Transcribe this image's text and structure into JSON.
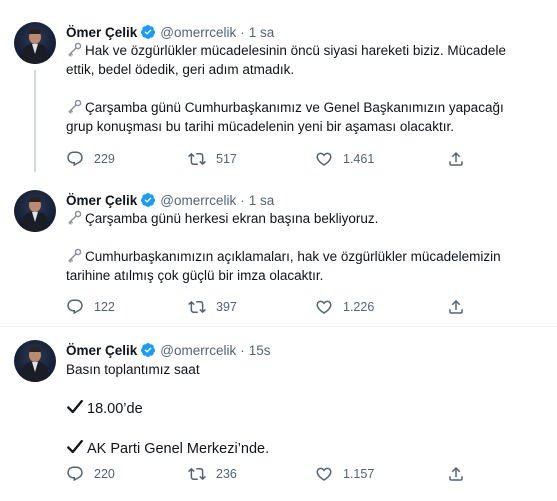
{
  "tweets": [
    {
      "author_name": "Ömer Çelik",
      "handle": "@omerrcelik",
      "separator": "·",
      "time": "1 sa",
      "paragraphs": [
        {
          "emoji": "key-icon",
          "lines": [
            "Hak ve özgürlükler mücadelesinin öncü siyasi hareketi biziz. Mücadele",
            "ettik, bedel ödedik, geri adım atmadık."
          ]
        },
        {
          "emoji": "key-icon",
          "lines": [
            "Çarşamba günü Cumhurbaşkanımız ve Genel Başkanımızın yapacağı",
            "grup konuşması bu tarihi mücadelenin yeni bir aşaması olacaktır."
          ]
        }
      ],
      "stats": {
        "replies": "229",
        "retweets": "517",
        "likes": "1.461"
      }
    },
    {
      "author_name": "Ömer Çelik",
      "handle": "@omerrcelik",
      "separator": "·",
      "time": "1 sa",
      "paragraphs": [
        {
          "emoji": "key-icon",
          "lines": [
            "Çarşamba günü herkesi ekran başına bekliyoruz."
          ]
        },
        {
          "emoji": "key-icon",
          "lines": [
            "Cumhurbaşkanımızın açıklamaları, hak ve özgürlükler mücadelemizin",
            "tarihine atılmış çok güçlü bir imza olacaktır."
          ]
        }
      ],
      "stats": {
        "replies": "122",
        "retweets": "397",
        "likes": "1.226"
      }
    },
    {
      "author_name": "Ömer Çelik",
      "handle": "@omerrcelik",
      "separator": "·",
      "time": "15s",
      "paragraphs": [
        {
          "emoji": "",
          "lines": [
            "Basın toplantımız saat"
          ]
        },
        {
          "emoji": "check-mark-icon",
          "lines": [
            "18.00’de"
          ]
        },
        {
          "emoji": "check-mark-icon",
          "lines": [
            "AK Parti Genel Merkezi’nde."
          ]
        }
      ],
      "stats": {
        "replies": "220",
        "retweets": "236",
        "likes": "1.157"
      }
    }
  ],
  "colors": {
    "text": "#0f1419",
    "secondary": "#536471",
    "verified": "#1d9bf0",
    "divider": "#eff3f4",
    "thread_line": "#cfd9de"
  }
}
